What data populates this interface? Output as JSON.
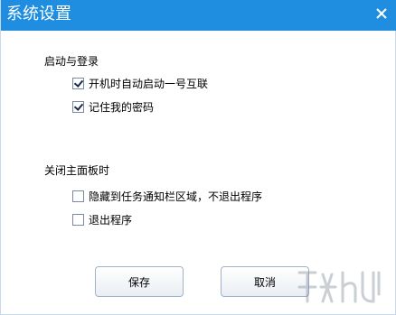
{
  "dialog": {
    "title": "系统设置",
    "close_icon": "close-icon"
  },
  "startup_section": {
    "title": "启动与登录",
    "options": [
      {
        "label": "开机时自动启动一号互联",
        "checked": true
      },
      {
        "label": "记住我的密码",
        "checked": true
      }
    ]
  },
  "close_section": {
    "title": "关闭主面板时",
    "options": [
      {
        "label": "隐藏到任务通知栏区域，不退出程序",
        "checked": false
      },
      {
        "label": "退出程序",
        "checked": false
      }
    ]
  },
  "buttons": {
    "save_label": "保存",
    "cancel_label": "取消"
  },
  "colors": {
    "titlebar": "#1f8ee1",
    "title_text": "#ffffff"
  }
}
